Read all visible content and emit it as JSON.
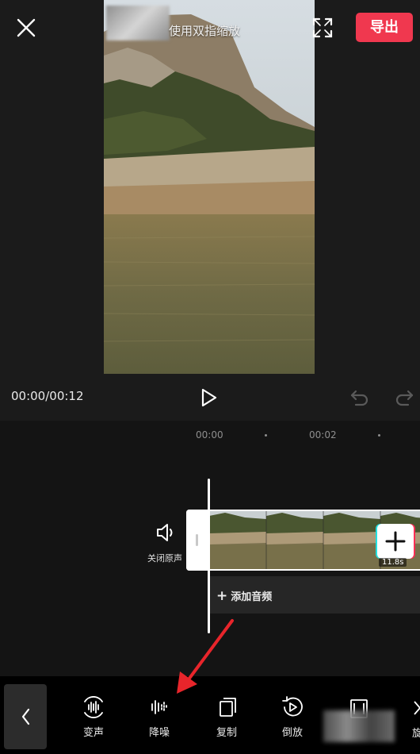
{
  "header": {
    "hint": "使用双指缩放",
    "export_label": "导出",
    "close_icon": "close-icon",
    "fullscreen_icon": "fullscreen-icon"
  },
  "player": {
    "timecode": "00:00/00:12",
    "play_icon": "play-icon",
    "undo_icon": "undo-icon",
    "redo_icon": "redo-icon"
  },
  "timeline": {
    "ticks": [
      "00:00",
      "00:02"
    ],
    "mute_label": "关闭原声",
    "clip_duration": "11.8s",
    "add_audio_label": "添加音频"
  },
  "toolbar": {
    "items": [
      {
        "label": "变声",
        "icon": "voice-change-icon"
      },
      {
        "label": "降噪",
        "icon": "noise-reduction-icon"
      },
      {
        "label": "复制",
        "icon": "copy-icon"
      },
      {
        "label": "倒放",
        "icon": "reverse-play-icon"
      }
    ],
    "partial_label": "旋"
  },
  "colors": {
    "accent": "#f0384f",
    "background": "#151515",
    "toolbar_bg": "#000000",
    "annotation_arrow": "#e8252b"
  }
}
